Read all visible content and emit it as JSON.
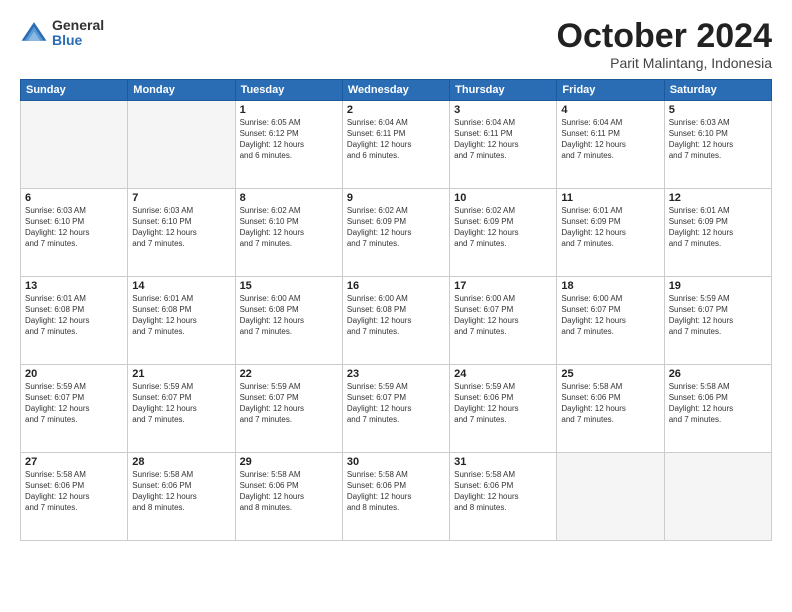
{
  "logo": {
    "general": "General",
    "blue": "Blue"
  },
  "title": "October 2024",
  "subtitle": "Parit Malintang, Indonesia",
  "days_header": [
    "Sunday",
    "Monday",
    "Tuesday",
    "Wednesday",
    "Thursday",
    "Friday",
    "Saturday"
  ],
  "weeks": [
    [
      {
        "day": "",
        "empty": true
      },
      {
        "day": "",
        "empty": true
      },
      {
        "day": "1",
        "sunrise": "6:05 AM",
        "sunset": "6:12 PM",
        "daylight": "12 hours and 6 minutes."
      },
      {
        "day": "2",
        "sunrise": "6:04 AM",
        "sunset": "6:11 PM",
        "daylight": "12 hours and 6 minutes."
      },
      {
        "day": "3",
        "sunrise": "6:04 AM",
        "sunset": "6:11 PM",
        "daylight": "12 hours and 7 minutes."
      },
      {
        "day": "4",
        "sunrise": "6:04 AM",
        "sunset": "6:11 PM",
        "daylight": "12 hours and 7 minutes."
      },
      {
        "day": "5",
        "sunrise": "6:03 AM",
        "sunset": "6:10 PM",
        "daylight": "12 hours and 7 minutes."
      }
    ],
    [
      {
        "day": "6",
        "sunrise": "6:03 AM",
        "sunset": "6:10 PM",
        "daylight": "12 hours and 7 minutes."
      },
      {
        "day": "7",
        "sunrise": "6:03 AM",
        "sunset": "6:10 PM",
        "daylight": "12 hours and 7 minutes."
      },
      {
        "day": "8",
        "sunrise": "6:02 AM",
        "sunset": "6:10 PM",
        "daylight": "12 hours and 7 minutes."
      },
      {
        "day": "9",
        "sunrise": "6:02 AM",
        "sunset": "6:09 PM",
        "daylight": "12 hours and 7 minutes."
      },
      {
        "day": "10",
        "sunrise": "6:02 AM",
        "sunset": "6:09 PM",
        "daylight": "12 hours and 7 minutes."
      },
      {
        "day": "11",
        "sunrise": "6:01 AM",
        "sunset": "6:09 PM",
        "daylight": "12 hours and 7 minutes."
      },
      {
        "day": "12",
        "sunrise": "6:01 AM",
        "sunset": "6:09 PM",
        "daylight": "12 hours and 7 minutes."
      }
    ],
    [
      {
        "day": "13",
        "sunrise": "6:01 AM",
        "sunset": "6:08 PM",
        "daylight": "12 hours and 7 minutes."
      },
      {
        "day": "14",
        "sunrise": "6:01 AM",
        "sunset": "6:08 PM",
        "daylight": "12 hours and 7 minutes."
      },
      {
        "day": "15",
        "sunrise": "6:00 AM",
        "sunset": "6:08 PM",
        "daylight": "12 hours and 7 minutes."
      },
      {
        "day": "16",
        "sunrise": "6:00 AM",
        "sunset": "6:08 PM",
        "daylight": "12 hours and 7 minutes."
      },
      {
        "day": "17",
        "sunrise": "6:00 AM",
        "sunset": "6:07 PM",
        "daylight": "12 hours and 7 minutes."
      },
      {
        "day": "18",
        "sunrise": "6:00 AM",
        "sunset": "6:07 PM",
        "daylight": "12 hours and 7 minutes."
      },
      {
        "day": "19",
        "sunrise": "5:59 AM",
        "sunset": "6:07 PM",
        "daylight": "12 hours and 7 minutes."
      }
    ],
    [
      {
        "day": "20",
        "sunrise": "5:59 AM",
        "sunset": "6:07 PM",
        "daylight": "12 hours and 7 minutes."
      },
      {
        "day": "21",
        "sunrise": "5:59 AM",
        "sunset": "6:07 PM",
        "daylight": "12 hours and 7 minutes."
      },
      {
        "day": "22",
        "sunrise": "5:59 AM",
        "sunset": "6:07 PM",
        "daylight": "12 hours and 7 minutes."
      },
      {
        "day": "23",
        "sunrise": "5:59 AM",
        "sunset": "6:07 PM",
        "daylight": "12 hours and 7 minutes."
      },
      {
        "day": "24",
        "sunrise": "5:59 AM",
        "sunset": "6:06 PM",
        "daylight": "12 hours and 7 minutes."
      },
      {
        "day": "25",
        "sunrise": "5:58 AM",
        "sunset": "6:06 PM",
        "daylight": "12 hours and 7 minutes."
      },
      {
        "day": "26",
        "sunrise": "5:58 AM",
        "sunset": "6:06 PM",
        "daylight": "12 hours and 7 minutes."
      }
    ],
    [
      {
        "day": "27",
        "sunrise": "5:58 AM",
        "sunset": "6:06 PM",
        "daylight": "12 hours and 7 minutes."
      },
      {
        "day": "28",
        "sunrise": "5:58 AM",
        "sunset": "6:06 PM",
        "daylight": "12 hours and 8 minutes."
      },
      {
        "day": "29",
        "sunrise": "5:58 AM",
        "sunset": "6:06 PM",
        "daylight": "12 hours and 8 minutes."
      },
      {
        "day": "30",
        "sunrise": "5:58 AM",
        "sunset": "6:06 PM",
        "daylight": "12 hours and 8 minutes."
      },
      {
        "day": "31",
        "sunrise": "5:58 AM",
        "sunset": "6:06 PM",
        "daylight": "12 hours and 8 minutes."
      },
      {
        "day": "",
        "empty": true
      },
      {
        "day": "",
        "empty": true
      }
    ]
  ],
  "labels": {
    "sunrise": "Sunrise:",
    "sunset": "Sunset:",
    "daylight": "Daylight:"
  }
}
